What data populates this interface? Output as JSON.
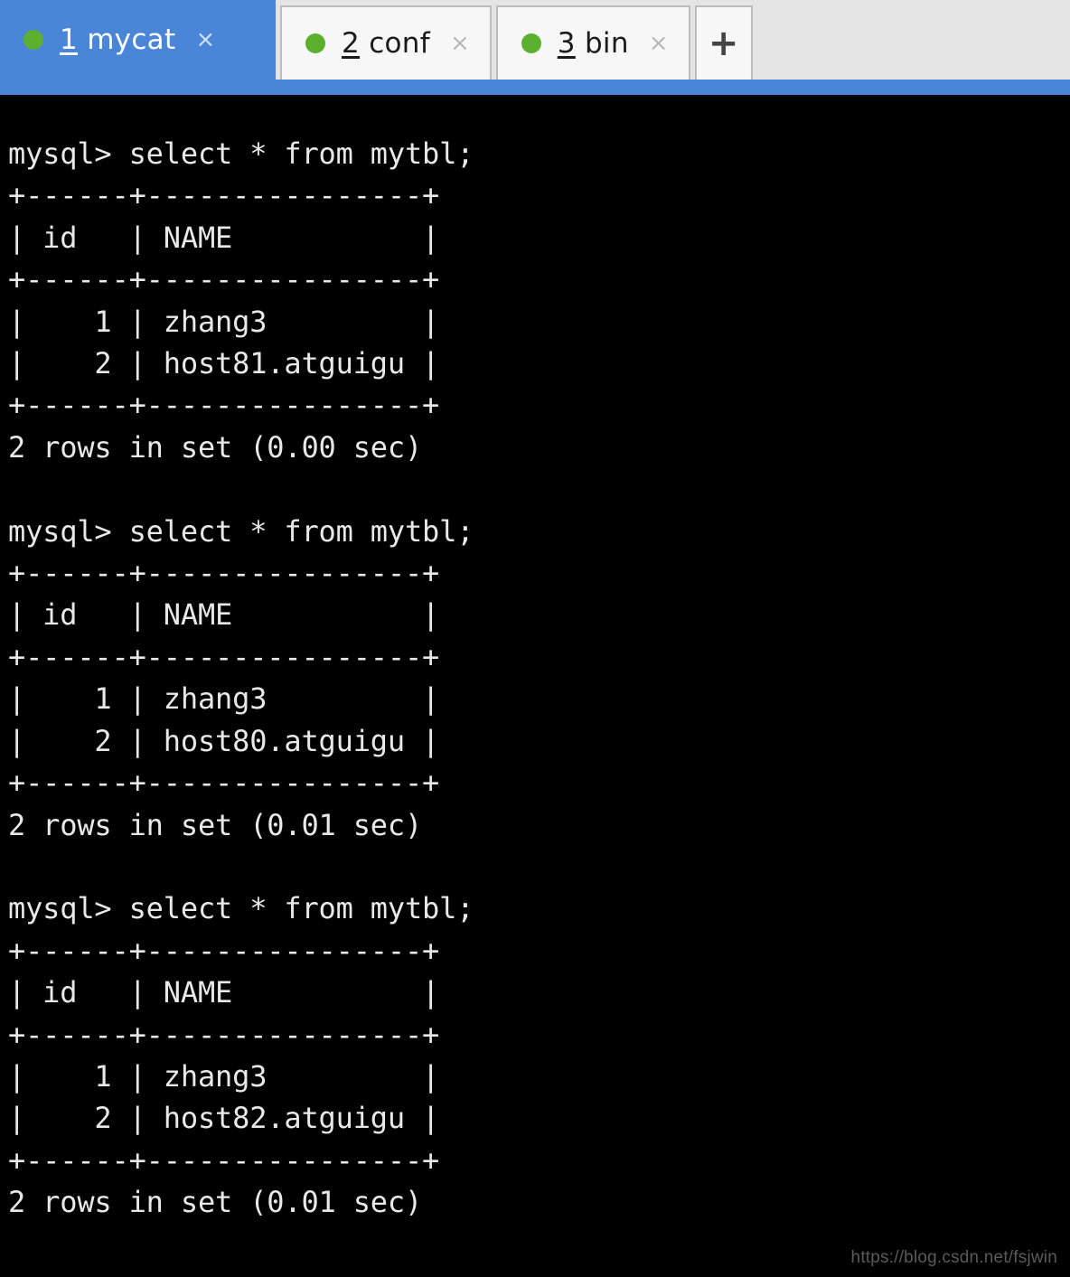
{
  "window": {
    "type": "terminal-emulator",
    "tab_bar_bg": "#e4e4e4",
    "active_tab_color": "#4a86d8",
    "status_dot_color": "#5bb12f",
    "terminal_bg": "#000000",
    "terminal_fg": "#e8e8e8"
  },
  "tabs": [
    {
      "index": "1",
      "number": "1",
      "name": "mycat",
      "label": "1 mycat",
      "active": true,
      "close_label": "×",
      "dot": "status-dot-green"
    },
    {
      "index": "2",
      "number": "2",
      "name": "conf",
      "label": "2 conf",
      "active": false,
      "close_label": "×",
      "dot": "status-dot-green"
    },
    {
      "index": "3",
      "number": "3",
      "name": "bin",
      "label": "3 bin",
      "active": false,
      "close_label": "×",
      "dot": "status-dot-green"
    }
  ],
  "new_tab_button": {
    "label": "+"
  },
  "terminal": {
    "prompt": "mysql>",
    "query": "select * from mytbl;",
    "blocks": [
      {
        "command_line": "mysql> select * from mytbl;",
        "columns": [
          "id",
          "NAME"
        ],
        "rows": [
          {
            "id": "1",
            "NAME": "zhang3"
          },
          {
            "id": "2",
            "NAME": "host81.atguigu"
          }
        ],
        "result_line": "2 rows in set (0.00 sec)",
        "row_count": "2",
        "elapsed": "0.00 sec"
      },
      {
        "command_line": "mysql> select * from mytbl;",
        "columns": [
          "id",
          "NAME"
        ],
        "rows": [
          {
            "id": "1",
            "NAME": "zhang3"
          },
          {
            "id": "2",
            "NAME": "host80.atguigu"
          }
        ],
        "result_line": "2 rows in set (0.01 sec)",
        "row_count": "2",
        "elapsed": "0.01 sec"
      },
      {
        "command_line": "mysql> select * from mytbl;",
        "columns": [
          "id",
          "NAME"
        ],
        "rows": [
          {
            "id": "1",
            "NAME": "zhang3"
          },
          {
            "id": "2",
            "NAME": "host82.atguigu"
          }
        ],
        "result_line": "2 rows in set (0.01 sec)",
        "row_count": "2",
        "elapsed": "0.01 sec"
      }
    ],
    "raw": "mysql> select * from mytbl;\n+------+----------------+\n| id   | NAME           |\n+------+----------------+\n|    1 | zhang3         |\n|    2 | host81.atguigu |\n+------+----------------+\n2 rows in set (0.00 sec)\n\nmysql> select * from mytbl;\n+------+----------------+\n| id   | NAME           |\n+------+----------------+\n|    1 | zhang3         |\n|    2 | host80.atguigu |\n+------+----------------+\n2 rows in set (0.01 sec)\n\nmysql> select * from mytbl;\n+------+----------------+\n| id   | NAME           |\n+------+----------------+\n|    1 | zhang3         |\n|    2 | host82.atguigu |\n+------+----------------+\n2 rows in set (0.01 sec)"
  },
  "watermark": {
    "text": "https://blog.csdn.net/fsjwin"
  }
}
